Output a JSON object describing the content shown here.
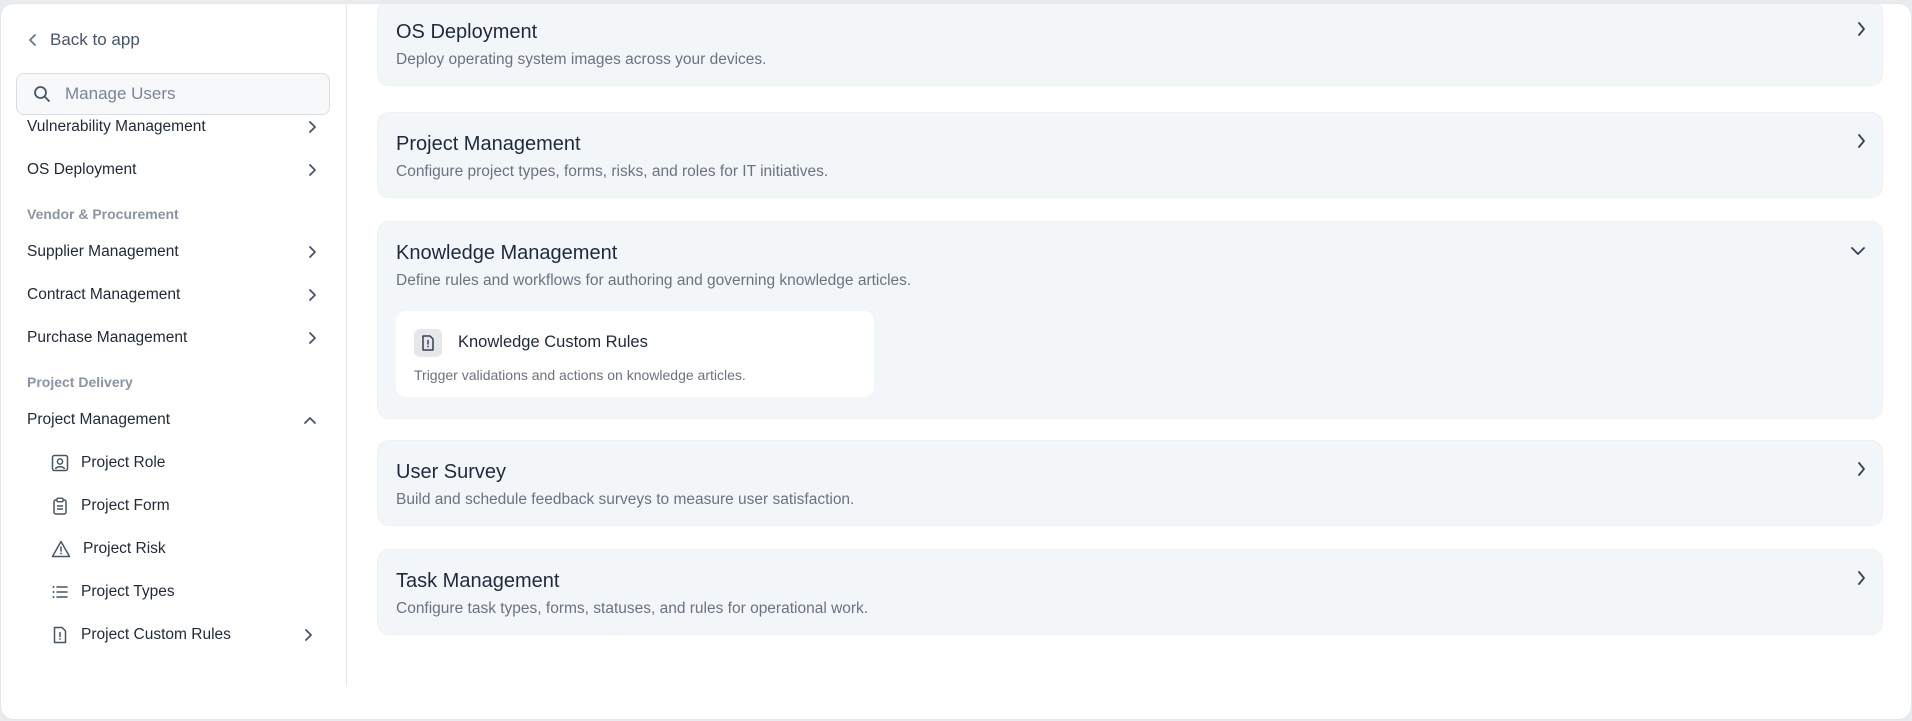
{
  "sidebar": {
    "back_label": "Back to app",
    "search_placeholder": "Manage Users",
    "items_top": [
      {
        "label": "Vulnerability Management"
      },
      {
        "label": "OS Deployment"
      }
    ],
    "section_vendor": "Vendor & Procurement",
    "items_vendor": [
      {
        "label": "Supplier Management"
      },
      {
        "label": "Contract Management"
      },
      {
        "label": "Purchase Management"
      }
    ],
    "section_delivery": "Project Delivery",
    "project_management": {
      "label": "Project Management",
      "expanded": true,
      "children": [
        {
          "label": "Project Role",
          "icon": "user-square-icon"
        },
        {
          "label": "Project Form",
          "icon": "clipboard-icon"
        },
        {
          "label": "Project Risk",
          "icon": "warning-icon"
        },
        {
          "label": "Project Types",
          "icon": "list-icon"
        },
        {
          "label": "Project Custom Rules",
          "icon": "file-alert-icon"
        }
      ]
    }
  },
  "cards": [
    {
      "title": "OS Deployment",
      "description": "Deploy operating system images across your devices.",
      "state": "collapsed"
    },
    {
      "title": "Project Management",
      "description": "Configure project types, forms, risks, and roles for IT initiatives.",
      "state": "collapsed"
    },
    {
      "title": "Knowledge Management",
      "description": "Define rules and workflows for authoring and governing knowledge articles.",
      "state": "expanded",
      "sub": {
        "title": "Knowledge Custom Rules",
        "description": "Trigger validations and actions on knowledge articles.",
        "icon": "file-alert-icon"
      }
    },
    {
      "title": "User Survey",
      "description": "Build and schedule feedback surveys to measure user satisfaction.",
      "state": "collapsed"
    },
    {
      "title": "Task Management",
      "description": "Configure task types, forms, statuses, and rules for operational work.",
      "state": "collapsed"
    }
  ],
  "colors": {
    "card_bg": "#f3f6f9",
    "text_primary": "#1e293b",
    "text_muted": "#6b7280",
    "section_label": "#8a94a3"
  }
}
